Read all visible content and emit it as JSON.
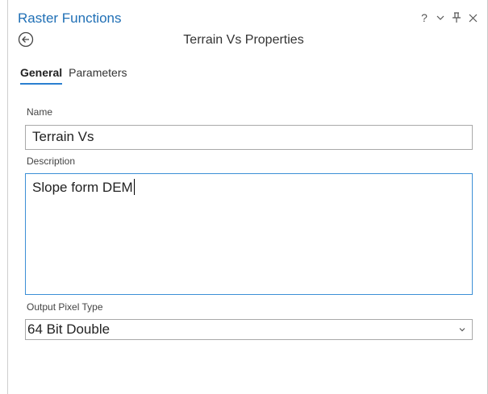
{
  "pane": {
    "title": "Raster Functions",
    "subtitle": "Terrain Vs Properties",
    "controls": {
      "help": "?",
      "menu": "⌄",
      "pin": "⊥",
      "close": "✕"
    }
  },
  "tabs": [
    {
      "label": "General",
      "active": true
    },
    {
      "label": "Parameters",
      "active": false
    }
  ],
  "form": {
    "name_label": "Name",
    "name_value": "Terrain Vs",
    "description_label": "Description",
    "description_value": "Slope form DEM",
    "pixel_type_label": "Output Pixel Type",
    "pixel_type_value": "64 Bit Double"
  },
  "icons": {
    "back": "back-arrow-icon",
    "dropdown": "chevron-down-icon"
  },
  "colors": {
    "title": "#1f6fb5",
    "tab_underline": "#2b7fd0",
    "focus_border": "#3c8fd6"
  }
}
